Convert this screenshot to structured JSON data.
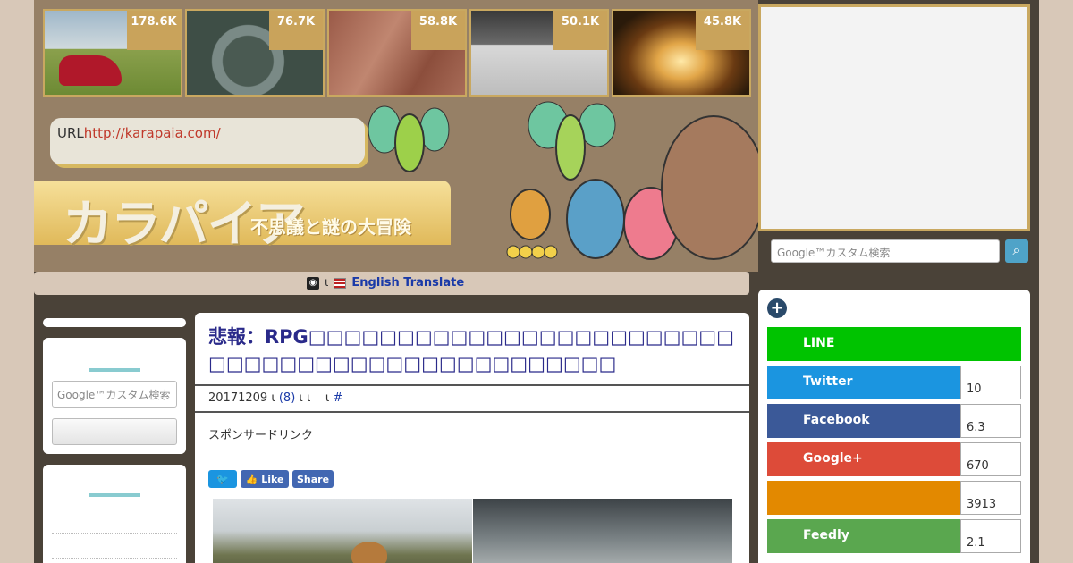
{
  "top_thumbs": [
    {
      "count": "178.6K"
    },
    {
      "count": "76.7K"
    },
    {
      "count": "58.8K"
    },
    {
      "count": "50.1K"
    },
    {
      "count": "45.8K"
    }
  ],
  "header": {
    "url_prefix": "URL",
    "url_link": "http://karapaia.com/",
    "logo_text": "カラパイア",
    "logo_sub": "不思議と謎の大冒険"
  },
  "translate": {
    "sep": "ι",
    "label": "English Translate"
  },
  "left_sidebar": {
    "search_placeholder": "Google™カスタム検索"
  },
  "article": {
    "title": "悲報：RPG□□□□□□□□□□□□□□□□□□□□□□□□□□□□□□□□□□□□□□□□□□□□□□□",
    "date": "20171209",
    "meta_sep1": "ι",
    "comments": "(8)",
    "meta_sep2": "ι ι",
    "meta_sep3": "ι",
    "hash": "#",
    "sponsor": "スポンサードリンク",
    "share_buttons": {
      "twitter": "",
      "like": "Like",
      "share": "Share"
    }
  },
  "right_sidebar": {
    "search_placeholder": "Google™カスタム検索",
    "share_rows": [
      {
        "label": "LINE",
        "count": "",
        "color": "#00c300"
      },
      {
        "label": "Twitter",
        "count": "10",
        "color": "#1b95e0"
      },
      {
        "label": "Facebook",
        "count": "6.3",
        "color": "#3b5998"
      },
      {
        "label": "Google+",
        "count": "670",
        "color": "#dd4b39"
      },
      {
        "label": "",
        "count": "3913",
        "color": "#e38900"
      },
      {
        "label": "Feedly",
        "count": "2.1",
        "color": "#5aa74f"
      }
    ]
  }
}
